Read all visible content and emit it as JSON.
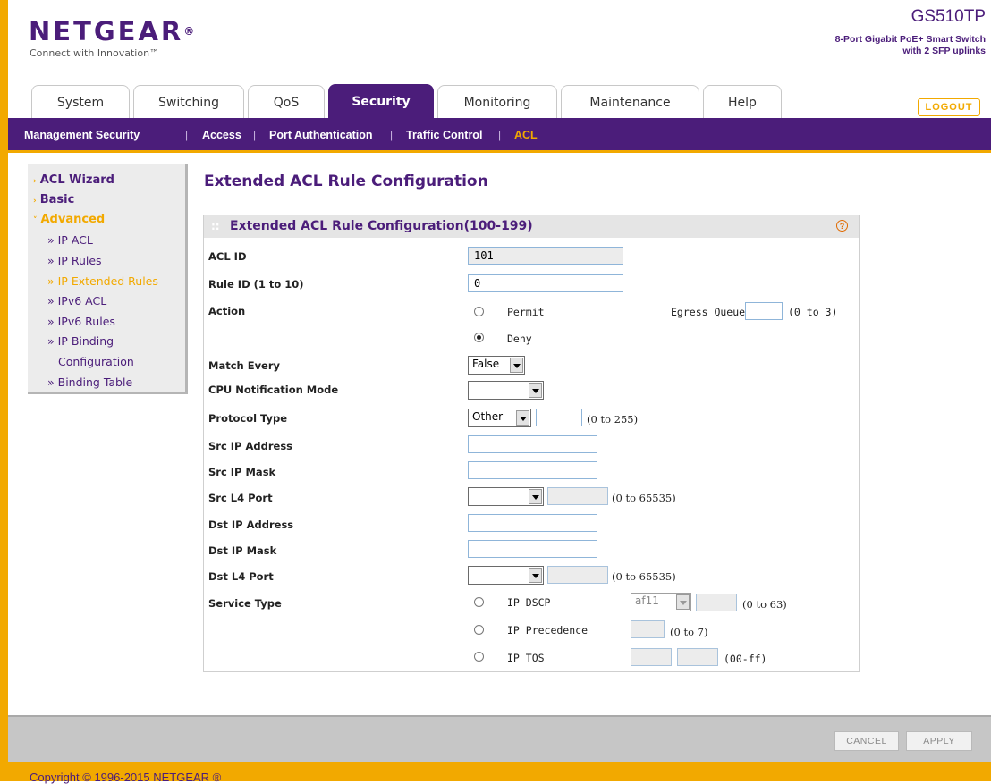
{
  "brand": {
    "logo": "NETGEAR",
    "logo_mark": "®",
    "tagline": "Connect with Innovation™",
    "model": "GS510TP",
    "model_desc_1": "8-Port Gigabit PoE+ Smart Switch",
    "model_desc_2": "with 2 SFP uplinks"
  },
  "tabs": [
    "System",
    "Switching",
    "QoS",
    "Security",
    "Monitoring",
    "Maintenance",
    "Help"
  ],
  "active_tab": "Security",
  "logout_label": "LOGOUT",
  "subnav": [
    "Management Security",
    "Access",
    "Port Authentication",
    "Traffic Control",
    "ACL"
  ],
  "active_subnav": "ACL",
  "sidebar": {
    "acl_wizard": "ACL Wizard",
    "basic": "Basic",
    "advanced": "Advanced",
    "items": [
      "» IP ACL",
      "» IP Rules",
      "» IP Extended Rules",
      "» IPv6 ACL",
      "» IPv6 Rules",
      "» IP Binding",
      "Configuration",
      "» Binding Table"
    ],
    "active_item": "» IP Extended Rules"
  },
  "page_title": "Extended ACL Rule Configuration",
  "panel_title": "Extended ACL Rule Configuration(100-199)",
  "help_icon_glyph": "?",
  "form": {
    "acl_id": {
      "label": "ACL ID",
      "value": "101"
    },
    "rule_id": {
      "label": "Rule ID (1 to 10)",
      "value": "0"
    },
    "action": {
      "label": "Action",
      "options": [
        "Permit",
        "Deny"
      ],
      "selected": "Deny",
      "egress_label": "Egress Queue",
      "egress_value": "",
      "egress_range": "(0 to 3)"
    },
    "match_every": {
      "label": "Match Every",
      "value": "False"
    },
    "cpu_notification": {
      "label": "CPU Notification Mode",
      "value": ""
    },
    "protocol_type": {
      "label": "Protocol Type",
      "value": "Other",
      "number": "",
      "range": "(0 to 255)"
    },
    "src_ip": {
      "label": "Src IP Address",
      "value": ""
    },
    "src_mask": {
      "label": "Src IP Mask",
      "value": ""
    },
    "src_l4": {
      "label": "Src L4 Port",
      "value": "",
      "number": "",
      "range": "(0 to 65535)"
    },
    "dst_ip": {
      "label": "Dst IP Address",
      "value": ""
    },
    "dst_mask": {
      "label": "Dst IP Mask",
      "value": ""
    },
    "dst_l4": {
      "label": "Dst L4 Port",
      "value": "",
      "number": "",
      "range": "(0 to 65535)"
    },
    "service_type": {
      "label": "Service Type",
      "dscp_label": "IP DSCP",
      "dscp_select": "af11",
      "dscp_range": "(0 to 63)",
      "prec_label": "IP Precedence",
      "prec_range": "(0 to 7)",
      "tos_label": "IP TOS",
      "tos_range": "(00-ff)"
    }
  },
  "buttons": {
    "cancel": "CANCEL",
    "apply": "APPLY"
  },
  "copyright": "Copyright © 1996-2015 NETGEAR ®",
  "colors": {
    "brand_purple": "#4b1d7a",
    "accent_orange": "#f2a900"
  }
}
